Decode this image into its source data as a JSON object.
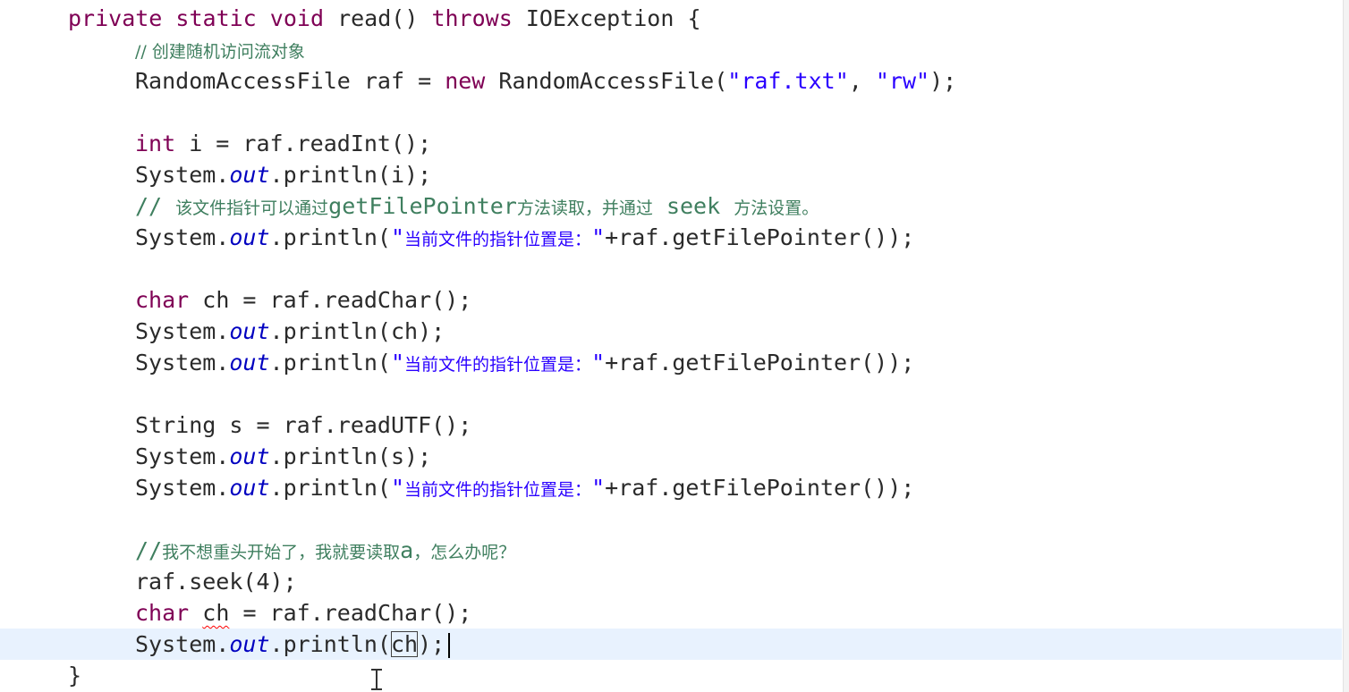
{
  "code": {
    "signature": {
      "kw1": "private",
      "kw2": "static",
      "kw3": "void",
      "name": "read()",
      "kw4": "throws",
      "exc": "IOException {"
    },
    "c1": "// 创建随机访问流对象",
    "raf_decl": {
      "type": "RandomAccessFile raf = ",
      "kw": "new",
      "ctor": " RandomAccessFile(",
      "s1": "\"raf.txt\"",
      "sep": ", ",
      "s2": "\"rw\"",
      "end": ");"
    },
    "int_line": {
      "kw": "int",
      "rest": " i = raf.readInt();"
    },
    "p_i": {
      "pre": "System.",
      "out": "out",
      "post": ".println(i);"
    },
    "c2": {
      "p1": "// ",
      "p2": "该文件指针可以通过",
      "p3": "getFilePointer",
      "p4": "方法读取，并通过",
      "p5": " seek ",
      "p6": "方法设置。"
    },
    "ptr": {
      "pre": "System.",
      "out": "out",
      "mid": ".println(",
      "q1": "\"",
      "cjk": "当前文件的指针位置是：",
      "q2": "\"",
      "post": "+raf.getFilePointer());"
    },
    "char1": {
      "kw": "char",
      "rest": " ch = raf.readChar();"
    },
    "p_ch": {
      "pre": "System.",
      "out": "out",
      "post": ".println(ch);"
    },
    "str_line": {
      "kw": "String s = raf.readUTF();"
    },
    "p_s": {
      "pre": "System.",
      "out": "out",
      "post": ".println(s);"
    },
    "c3": {
      "p1": "//",
      "p2": "我不想重头开始了，我就要读取",
      "p3": "a",
      "p4": "，怎么办呢？"
    },
    "seek": "raf.seek(4);",
    "char2": {
      "kw": "char",
      "sp": " ",
      "ch": "ch",
      "rest": " = raf.readChar();"
    },
    "last": {
      "pre": "System.",
      "out": "out",
      "mid": ".println(",
      "ch": "ch",
      "post": ");"
    },
    "close": "}"
  }
}
